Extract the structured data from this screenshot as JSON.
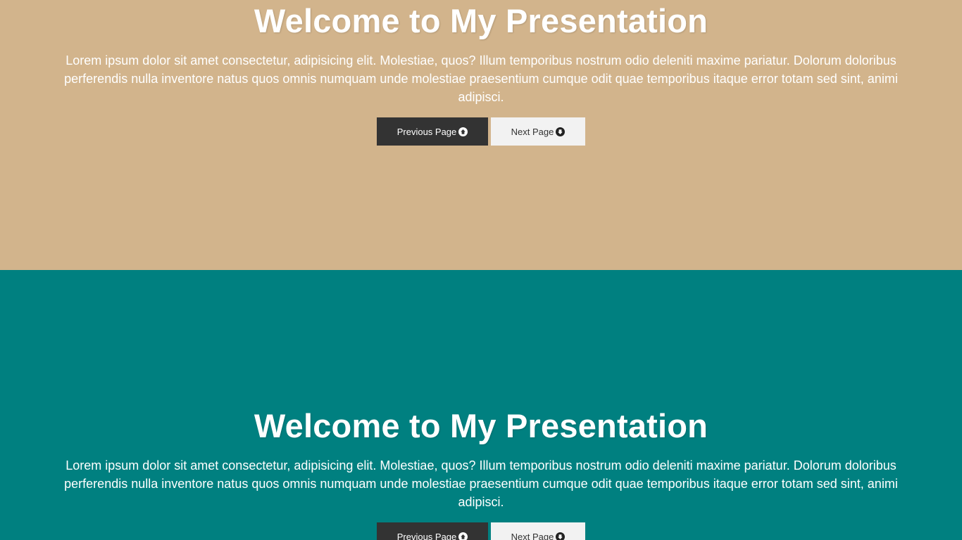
{
  "colors": {
    "section1_bg": "#d2b48c",
    "section2_bg": "#008080",
    "prev_button_bg": "#333333",
    "next_button_bg": "#f2f2f2"
  },
  "sections": [
    {
      "title": "Welcome to My Presentation",
      "body": "Lorem ipsum dolor sit amet consectetur, adipisicing elit. Molestiae, quos? Illum temporibus nostrum odio deleniti maxime pariatur. Dolorum doloribus perferendis nulla inventore natus quos omnis numquam unde molestiae praesentium cumque odit quae temporibus itaque error totam sed sint, animi adipisci.",
      "prev_label": "Previous Page",
      "prev_icon": "arrow-circle-up-icon",
      "next_label": "Next Page",
      "next_icon": "arrow-circle-down-icon"
    },
    {
      "title": "Welcome to My Presentation",
      "body": "Lorem ipsum dolor sit amet consectetur, adipisicing elit. Molestiae, quos? Illum temporibus nostrum odio deleniti maxime pariatur. Dolorum doloribus perferendis nulla inventore natus quos omnis numquam unde molestiae praesentium cumque odit quae temporibus itaque error totam sed sint, animi adipisci.",
      "prev_label": "Previous Page",
      "prev_icon": "arrow-circle-up-icon",
      "next_label": "Next Page",
      "next_icon": "arrow-circle-down-icon"
    }
  ]
}
